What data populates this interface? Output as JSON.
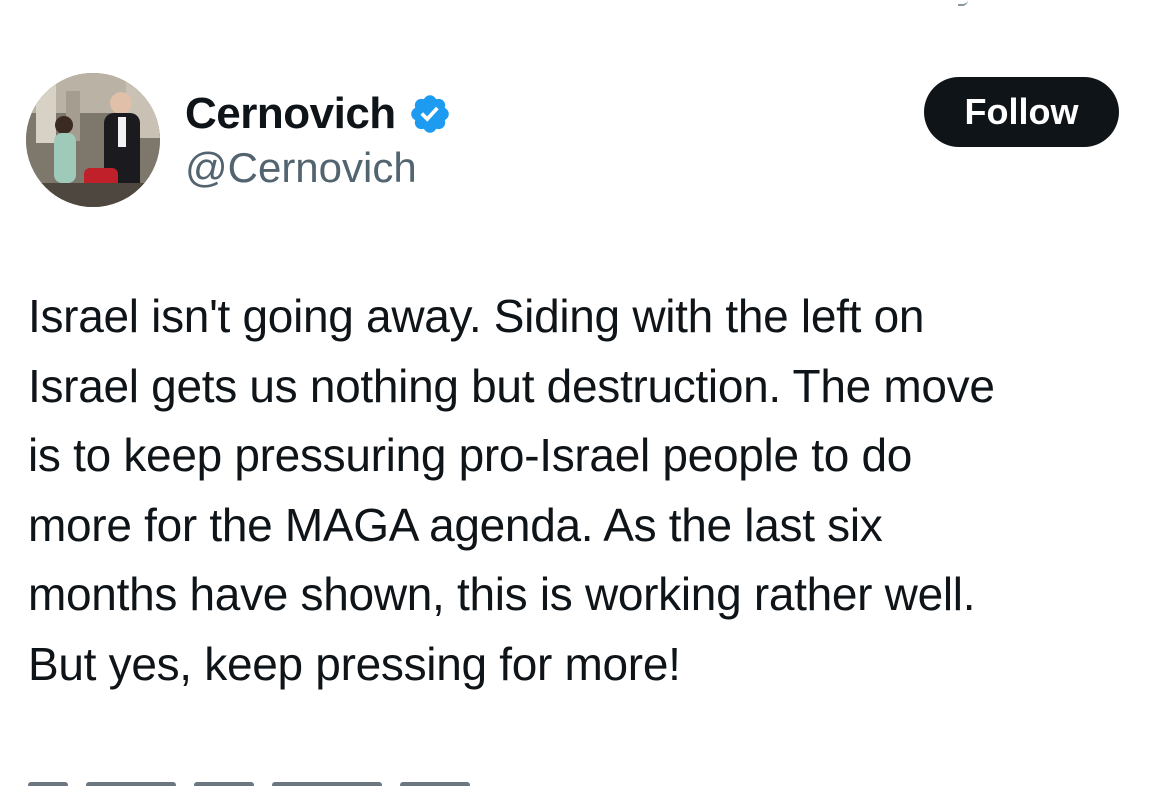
{
  "author": {
    "display_name": "Cernovich",
    "handle": "@Cernovich",
    "verified": true,
    "verified_color": "#1d9bf0"
  },
  "follow_button": {
    "label": "Follow"
  },
  "tweet": {
    "text": "Israel isn't going away. Siding with the left on\nIsrael gets us nothing but destruction. The move\nis to keep pressuring pro-Israel people to do\nmore for the MAGA agenda. As the last six\nmonths have shown, this is working rather well.\nBut yes, keep pressing for more!"
  },
  "colors": {
    "text_primary": "#0f1419",
    "text_secondary": "#536471",
    "button_bg": "#0f1419",
    "button_text": "#ffffff"
  }
}
